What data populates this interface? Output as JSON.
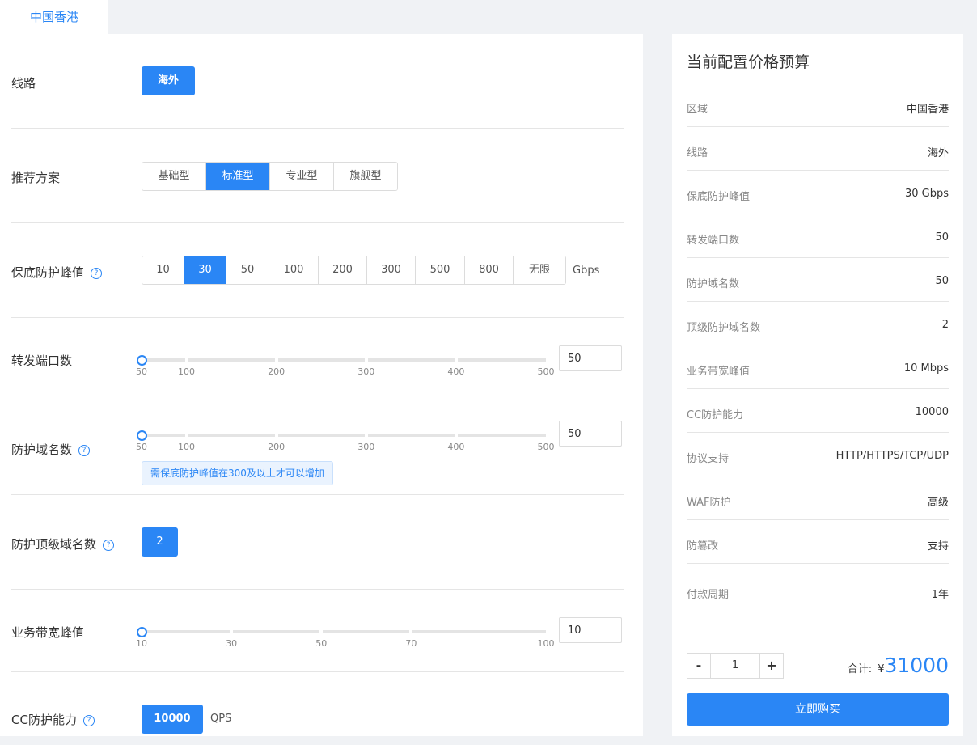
{
  "tab": {
    "label": "中国香港"
  },
  "form": {
    "line": {
      "label": "线路",
      "value": "海外"
    },
    "plan": {
      "label": "推荐方案",
      "options": [
        "基础型",
        "标准型",
        "专业型",
        "旗舰型"
      ],
      "selected": "标准型"
    },
    "protect_peak": {
      "label": "保底防护峰值",
      "options": [
        "10",
        "30",
        "50",
        "100",
        "200",
        "300",
        "500",
        "800",
        "无限"
      ],
      "selected": "30",
      "unit": "Gbps"
    },
    "ports": {
      "label": "转发端口数",
      "ticks": [
        "50",
        "100",
        "200",
        "300",
        "400",
        "500"
      ],
      "value": "50",
      "min": 50,
      "max": 500
    },
    "domains": {
      "label": "防护域名数",
      "ticks": [
        "50",
        "100",
        "200",
        "300",
        "400",
        "500"
      ],
      "value": "50",
      "min": 50,
      "max": 500,
      "tip": "需保底防护峰值在300及以上才可以增加"
    },
    "top_domains": {
      "label": "防护顶级域名数",
      "value": "2"
    },
    "bandwidth": {
      "label": "业务带宽峰值",
      "ticks": [
        "10",
        "30",
        "50",
        "70",
        "100"
      ],
      "value": "10",
      "min": 10,
      "max": 100
    },
    "cc": {
      "label": "CC防护能力",
      "value": "10000",
      "unit": "QPS"
    },
    "help_icon": "?"
  },
  "summary": {
    "title": "当前配置价格预算",
    "rows": [
      {
        "k": "区域",
        "v": "中国香港"
      },
      {
        "k": "线路",
        "v": "海外"
      },
      {
        "k": "保底防护峰值",
        "v": "30 Gbps"
      },
      {
        "k": "转发端口数",
        "v": "50"
      },
      {
        "k": "防护域名数",
        "v": "50"
      },
      {
        "k": "顶级防护域名数",
        "v": "2"
      },
      {
        "k": "业务带宽峰值",
        "v": "10 Mbps"
      },
      {
        "k": "CC防护能力",
        "v": "10000"
      },
      {
        "k": "协议支持",
        "v": "HTTP/HTTPS/TCP/UDP"
      },
      {
        "k": "WAF防护",
        "v": "高级"
      },
      {
        "k": "防篡改",
        "v": "支持"
      },
      {
        "k": "付款周期",
        "v": "1年"
      }
    ],
    "quantity": {
      "minus": "-",
      "value": "1",
      "plus": "+"
    },
    "total_label": "合计:",
    "currency": "¥",
    "total": "31000",
    "buy_label": "立即购买"
  },
  "colors": {
    "accent": "#2a86f5"
  }
}
